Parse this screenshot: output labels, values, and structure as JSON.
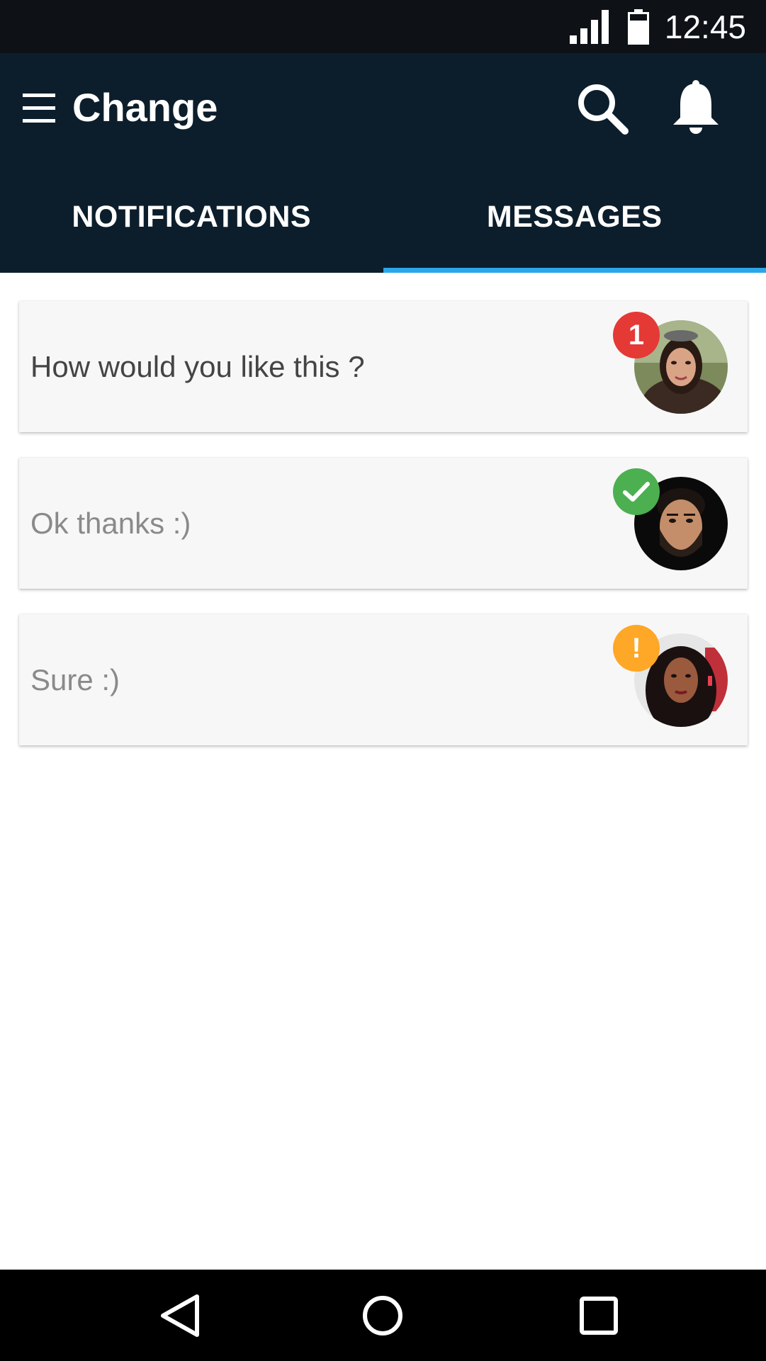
{
  "status_bar": {
    "time": "12:45",
    "signal_icon": "cellular-signal-icon",
    "battery_icon": "battery-icon"
  },
  "app_bar": {
    "title": "Change",
    "menu_icon": "hamburger-menu-icon",
    "search_icon": "search-icon",
    "bell_icon": "bell-icon"
  },
  "tabs": [
    {
      "label": "NOTIFICATIONS",
      "active": false
    },
    {
      "label": "MESSAGES",
      "active": true
    }
  ],
  "messages": [
    {
      "text": "How would you like this ?",
      "badge": "1",
      "badge_type": "unread-count",
      "badge_color": "#e53935",
      "read": false
    },
    {
      "text": "Ok thanks :)",
      "badge": "",
      "badge_type": "check-icon",
      "badge_color": "#4caf50",
      "read": true
    },
    {
      "text": "Sure :)",
      "badge": "!",
      "badge_type": "exclamation",
      "badge_color": "#ffa726",
      "read": true
    }
  ],
  "colors": {
    "app_bar": "#0c1e2c",
    "status_bar": "#0e1216",
    "tab_indicator": "#2aa6ea"
  },
  "nav_bar": {
    "back_icon": "back-triangle-icon",
    "home_icon": "home-circle-icon",
    "recents_icon": "recents-square-icon"
  }
}
